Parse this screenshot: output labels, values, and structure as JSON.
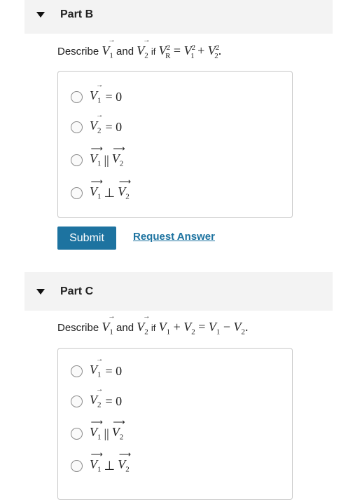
{
  "part_b": {
    "title": "Part B",
    "question": {
      "prefix": "Describe",
      "and": "and",
      "if": "if",
      "equation": {
        "lhs_sub": "R",
        "exp": "2",
        "eq": "=",
        "plus": "+"
      }
    },
    "options": [
      {
        "sub": "1",
        "relation": "= 0"
      },
      {
        "sub": "2",
        "relation": "= 0"
      },
      {
        "sub1": "1",
        "relation": "||",
        "sub2": "2"
      },
      {
        "sub1": "1",
        "relation": "⊥",
        "sub2": "2"
      }
    ],
    "submit_label": "Submit",
    "request_label": "Request Answer"
  },
  "part_c": {
    "title": "Part C",
    "question": {
      "prefix": "Describe",
      "and": "and",
      "if": "if",
      "equation": {
        "plus": "+",
        "eq": "=",
        "minus": "−"
      }
    },
    "options": [
      {
        "sub": "1",
        "relation": "= 0"
      },
      {
        "sub": "2",
        "relation": "= 0"
      },
      {
        "sub1": "1",
        "relation": "||",
        "sub2": "2"
      },
      {
        "sub1": "1",
        "relation": "⊥",
        "sub2": "2"
      }
    ]
  },
  "symbols": {
    "var": "V",
    "arrow": "→",
    "wide_arrow": "⟶"
  },
  "colors": {
    "accent": "#1d73a0",
    "header_bg": "#f3f3f3",
    "border": "#c8c8c8"
  }
}
